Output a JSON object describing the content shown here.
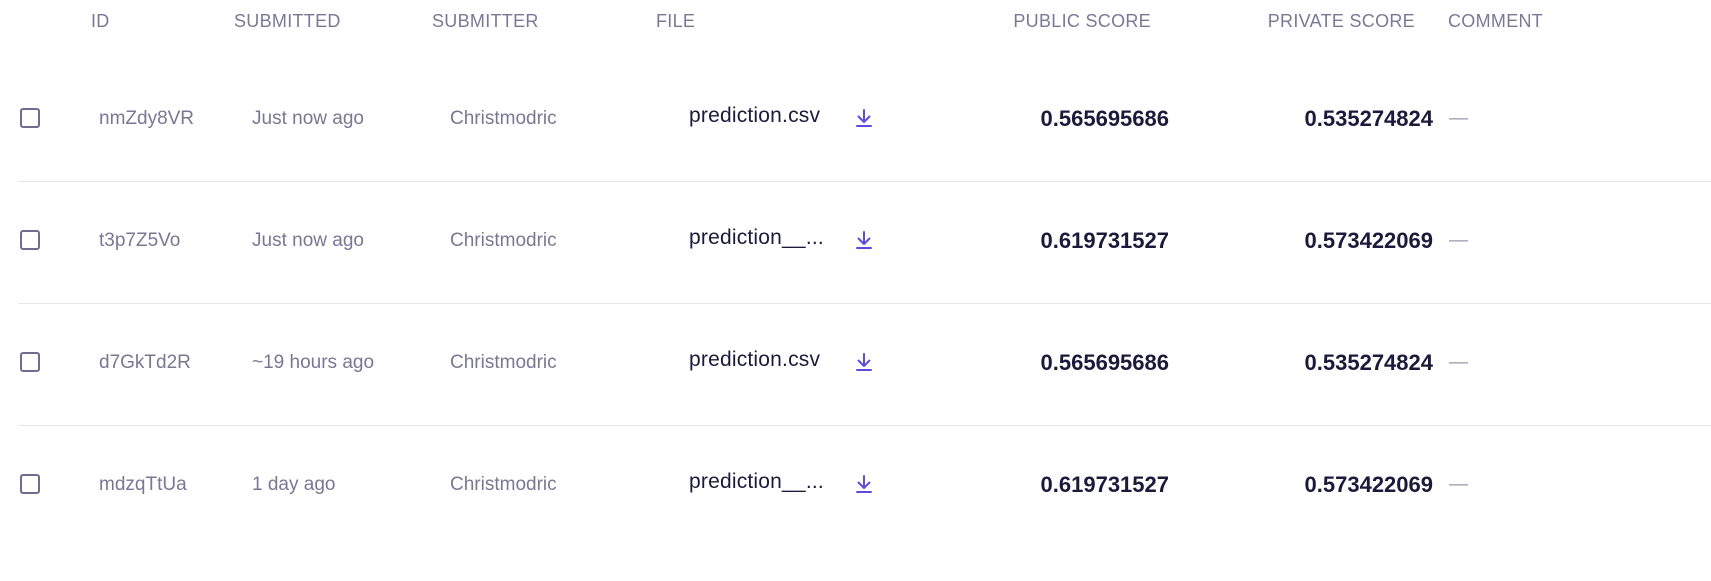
{
  "columns": {
    "id": "ID",
    "submitted": "SUBMITTED",
    "submitter": "SUBMITTER",
    "file": "FILE",
    "public_score": "PUBLIC SCORE",
    "private_score": "PRIVATE SCORE",
    "comment": "COMMENT"
  },
  "rows": [
    {
      "id": "nmZdy8VR",
      "submitted": "Just now ago",
      "submitter": "Christmodric",
      "file": "prediction.csv",
      "public_score": "0.565695686",
      "private_score": "0.535274824",
      "comment": "—"
    },
    {
      "id": "t3p7Z5Vo",
      "submitted": "Just now ago",
      "submitter": "Christmodric",
      "file": "prediction__...",
      "public_score": "0.619731527",
      "private_score": "0.573422069",
      "comment": "—"
    },
    {
      "id": "d7GkTd2R",
      "submitted": "~19 hours ago",
      "submitter": "Christmodric",
      "file": "prediction.csv",
      "public_score": "0.565695686",
      "private_score": "0.535274824",
      "comment": "—"
    },
    {
      "id": "mdzqTtUa",
      "submitted": "1 day ago",
      "submitter": "Christmodric",
      "file": "prediction__...",
      "public_score": "0.619731527",
      "private_score": "0.573422069",
      "comment": "—"
    }
  ],
  "icons": {
    "download": "download-icon",
    "checkbox": "checkbox-unchecked"
  },
  "colors": {
    "accent": "#5b4de0",
    "text_dark": "#1c1a3b",
    "text_muted": "#7a7793",
    "divider": "#e6e6ec"
  }
}
